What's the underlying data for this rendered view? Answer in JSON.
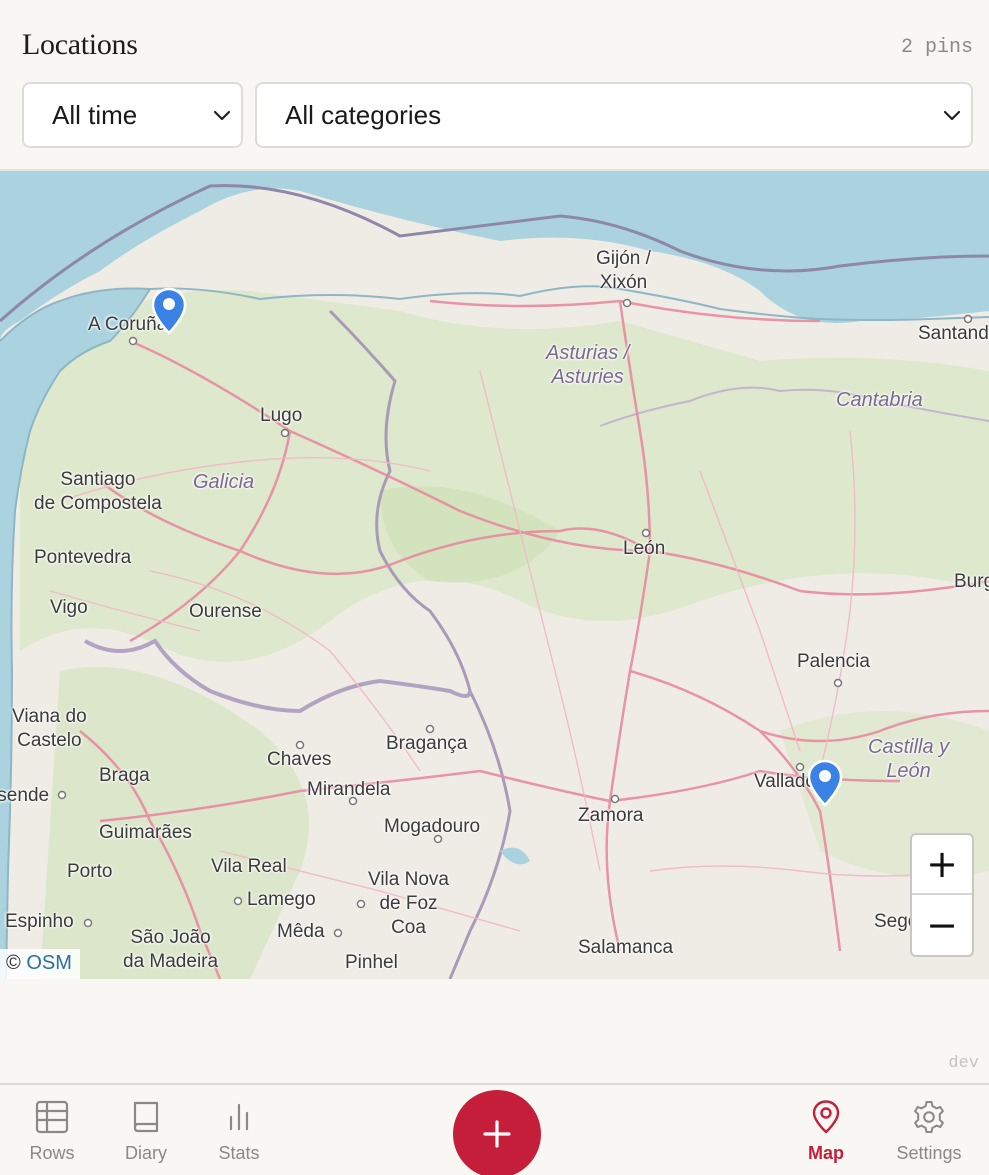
{
  "header": {
    "title": "Locations",
    "pin_count": "2 pins",
    "time_filter": "All time",
    "category_filter": "All categories"
  },
  "map": {
    "places": [
      {
        "name": "Gijón /\nXixón",
        "kind": "city"
      },
      {
        "name": "A Coruña",
        "kind": "city"
      },
      {
        "name": "Santander",
        "kind": "city"
      },
      {
        "name": "Asturias /\nAsturies",
        "kind": "region"
      },
      {
        "name": "Cantabria",
        "kind": "region"
      },
      {
        "name": "Lugo",
        "kind": "city"
      },
      {
        "name": "Santiago\nde Compostela",
        "kind": "city"
      },
      {
        "name": "Galicia",
        "kind": "region"
      },
      {
        "name": "León",
        "kind": "city"
      },
      {
        "name": "Pontevedra",
        "kind": "city"
      },
      {
        "name": "Vigo",
        "kind": "city"
      },
      {
        "name": "Ourense",
        "kind": "city"
      },
      {
        "name": "Burgos",
        "kind": "city"
      },
      {
        "name": "Palencia",
        "kind": "city"
      },
      {
        "name": "Viana do\nCastelo",
        "kind": "city"
      },
      {
        "name": "Bragança",
        "kind": "city"
      },
      {
        "name": "Chaves",
        "kind": "city"
      },
      {
        "name": "Castilla y\nLeón",
        "kind": "region"
      },
      {
        "name": "Braga",
        "kind": "city"
      },
      {
        "name": "Mirandela",
        "kind": "city"
      },
      {
        "name": "Valladolid",
        "kind": "city"
      },
      {
        "name": "Esposende",
        "kind": "city"
      },
      {
        "name": "Mogadouro",
        "kind": "city"
      },
      {
        "name": "Zamora",
        "kind": "city"
      },
      {
        "name": "Guimarães",
        "kind": "city"
      },
      {
        "name": "Vila Real",
        "kind": "city"
      },
      {
        "name": "Porto",
        "kind": "city"
      },
      {
        "name": "Vila Nova\nde Foz\nCoa",
        "kind": "city"
      },
      {
        "name": "Lamego",
        "kind": "city"
      },
      {
        "name": "Espinho",
        "kind": "city"
      },
      {
        "name": "Mêda",
        "kind": "city"
      },
      {
        "name": "Segovia",
        "kind": "city"
      },
      {
        "name": "São João\nda Madeira",
        "kind": "city"
      },
      {
        "name": "Pinhel",
        "kind": "city"
      },
      {
        "name": "Salamanca",
        "kind": "city"
      }
    ],
    "pins": [
      {
        "near": "A Coruña",
        "color": "#3b82e6"
      },
      {
        "near": "Valladolid",
        "color": "#3b82e6"
      }
    ],
    "zoom_in": "+",
    "zoom_out": "−",
    "attribution_prefix": "©",
    "attribution_link": "OSM"
  },
  "build_tag": "dev",
  "nav": {
    "items": [
      {
        "label": "Rows",
        "icon": "table-icon",
        "active": false
      },
      {
        "label": "Diary",
        "icon": "book-icon",
        "active": false
      },
      {
        "label": "Stats",
        "icon": "bar-chart-icon",
        "active": false
      },
      {
        "label": "Map",
        "icon": "map-pin-icon",
        "active": true
      },
      {
        "label": "Settings",
        "icon": "gear-icon",
        "active": false
      }
    ],
    "fab_icon": "plus-icon"
  },
  "colors": {
    "accent": "#c41e3a",
    "sea": "#aad3df",
    "land": "#efece6",
    "pin": "#3b82e6"
  }
}
